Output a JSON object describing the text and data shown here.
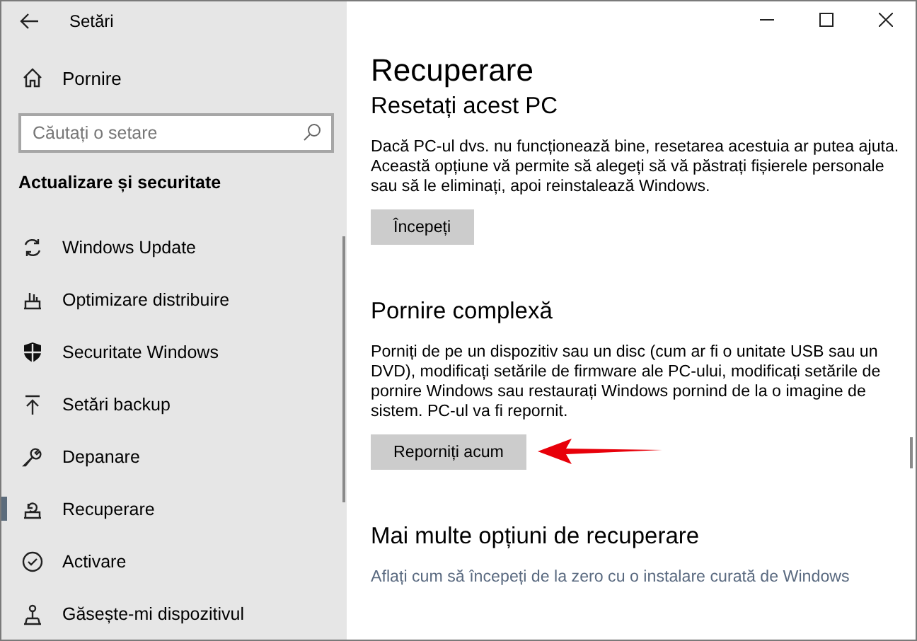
{
  "window": {
    "title": "Setări"
  },
  "sidebar": {
    "home": "Pornire",
    "search": {
      "placeholder": "Căutați o setare"
    },
    "section": "Actualizare și securitate",
    "items": [
      {
        "label": "Windows Update",
        "selected": false
      },
      {
        "label": "Optimizare distribuire",
        "selected": false
      },
      {
        "label": "Securitate Windows",
        "selected": false
      },
      {
        "label": "Setări backup",
        "selected": false
      },
      {
        "label": "Depanare",
        "selected": false
      },
      {
        "label": "Recuperare",
        "selected": true
      },
      {
        "label": "Activare",
        "selected": false
      },
      {
        "label": "Găsește-mi dispozitivul",
        "selected": false
      }
    ]
  },
  "page": {
    "title": "Recuperare",
    "sections": [
      {
        "heading": "Resetați acest PC",
        "text": "Dacă PC-ul dvs. nu funcționează bine, resetarea acestuia ar putea ajuta. Această opțiune vă permite să alegeți să vă păstrați fișierele personale sau să le eliminați, apoi reinstalează Windows.",
        "button": "Începeți",
        "highlighted": false
      },
      {
        "heading": "Pornire complexă",
        "text": "Porniți de pe un dispozitiv sau un disc (cum ar fi o unitate USB sau un DVD), modificați setările de firmware ale PC-ului, modificați setările de pornire Windows sau restaurați Windows pornind de la o imagine de sistem. PC-ul va fi repornit.",
        "button": "Reporniți acum",
        "highlighted": true
      },
      {
        "heading": "Mai multe opțiuni de recuperare",
        "link": "Aflați cum să începeți de la zero cu o instalare curată de Windows"
      }
    ]
  }
}
